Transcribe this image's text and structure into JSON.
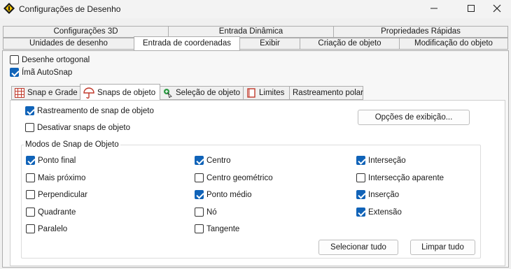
{
  "window": {
    "title": "Configurações de Desenho"
  },
  "tabs_row1": [
    "Configurações 3D",
    "Entrada Dinâmica",
    "Propriedades Rápidas"
  ],
  "tabs_row2": [
    "Unidades de desenho",
    "Entrada de coordenadas",
    "Exibir",
    "Criação de objeto",
    "Modificação do objeto"
  ],
  "options": {
    "ortho_label": "Desenhe ortogonal",
    "ortho_checked": false,
    "magnet_label": "Ímã AutoSnap",
    "magnet_checked": true
  },
  "subtabs": [
    "Snap e Grade",
    "Snaps de objeto",
    "Seleção de objeto",
    "Limites",
    "Rastreamento polar"
  ],
  "snap_panel": {
    "tracking_label": "Rastreamento de snap de objeto",
    "disable_label": "Desativar snaps de objeto",
    "display_options_button": "Opções de exibição...",
    "modes_title": "Modos de Snap de Objeto",
    "modes": [
      {
        "label": "Ponto final",
        "checked": true
      },
      {
        "label": "Mais próximo",
        "checked": false
      },
      {
        "label": "Perpendicular",
        "checked": false
      },
      {
        "label": "Quadrante",
        "checked": false
      },
      {
        "label": "Paralelo",
        "checked": false
      },
      {
        "label": "Centro",
        "checked": true
      },
      {
        "label": "Centro geométrico",
        "checked": false
      },
      {
        "label": "Ponto médio",
        "checked": true
      },
      {
        "label": "Nó",
        "checked": false
      },
      {
        "label": "Tangente",
        "checked": false
      },
      {
        "label": "Interseção",
        "checked": true
      },
      {
        "label": "Intersecção aparente",
        "checked": false
      },
      {
        "label": "Inserção",
        "checked": true
      },
      {
        "label": "Extensão",
        "checked": true
      }
    ],
    "select_all_button": "Selecionar tudo",
    "clear_all_button": "Limpar tudo"
  }
}
